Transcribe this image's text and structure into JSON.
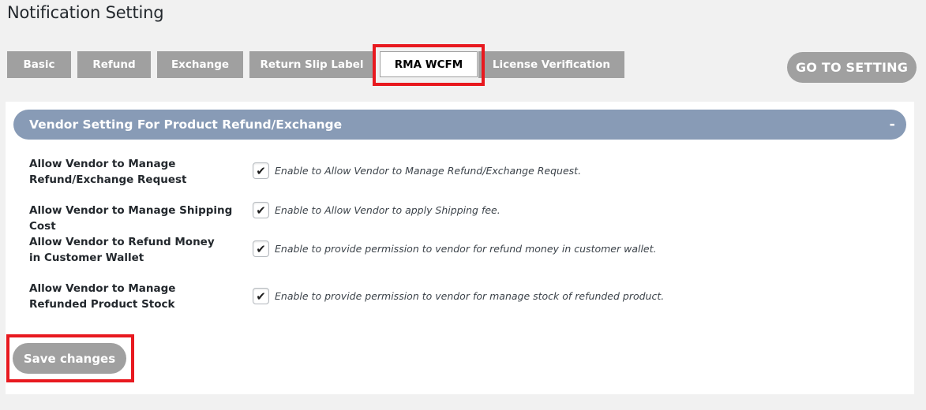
{
  "page": {
    "title": "Notification Setting"
  },
  "tabs": [
    {
      "label": "Basic",
      "active": false
    },
    {
      "label": "Refund",
      "active": false
    },
    {
      "label": "Exchange",
      "active": false
    },
    {
      "label": "Return Slip Label",
      "active": false
    },
    {
      "label": "RMA WCFM",
      "active": true
    },
    {
      "label": "License Verification",
      "active": false
    }
  ],
  "header_actions": {
    "go_to_setting_label": "GO TO SETTING"
  },
  "section": {
    "title": "Vendor Setting For Product Refund/Exchange",
    "toggle_symbol": "-",
    "rows": [
      {
        "label": "Allow Vendor to Manage Refund/Exchange Request",
        "checked": true,
        "check_symbol": "✔",
        "description": "Enable to Allow Vendor to Manage Refund/Exchange Request."
      },
      {
        "label": "Allow Vendor to Manage Shipping Cost",
        "checked": true,
        "check_symbol": "✔",
        "description": "Enable to Allow Vendor to apply Shipping fee."
      },
      {
        "label": "Allow Vendor to Refund Money in Customer Wallet",
        "checked": true,
        "check_symbol": "✔",
        "description": "Enable to provide permission to vendor for refund money in customer wallet."
      },
      {
        "label": "Allow Vendor to Manage Refunded Product Stock",
        "checked": true,
        "check_symbol": "✔",
        "description": "Enable to provide permission to vendor for manage stock of refunded product."
      }
    ]
  },
  "footer": {
    "save_label": "Save changes"
  },
  "colors": {
    "tab_bg": "#a0a0a0",
    "section_header_bg": "#889bb6",
    "highlight": "#e8191f",
    "page_bg": "#f1f1f1"
  }
}
